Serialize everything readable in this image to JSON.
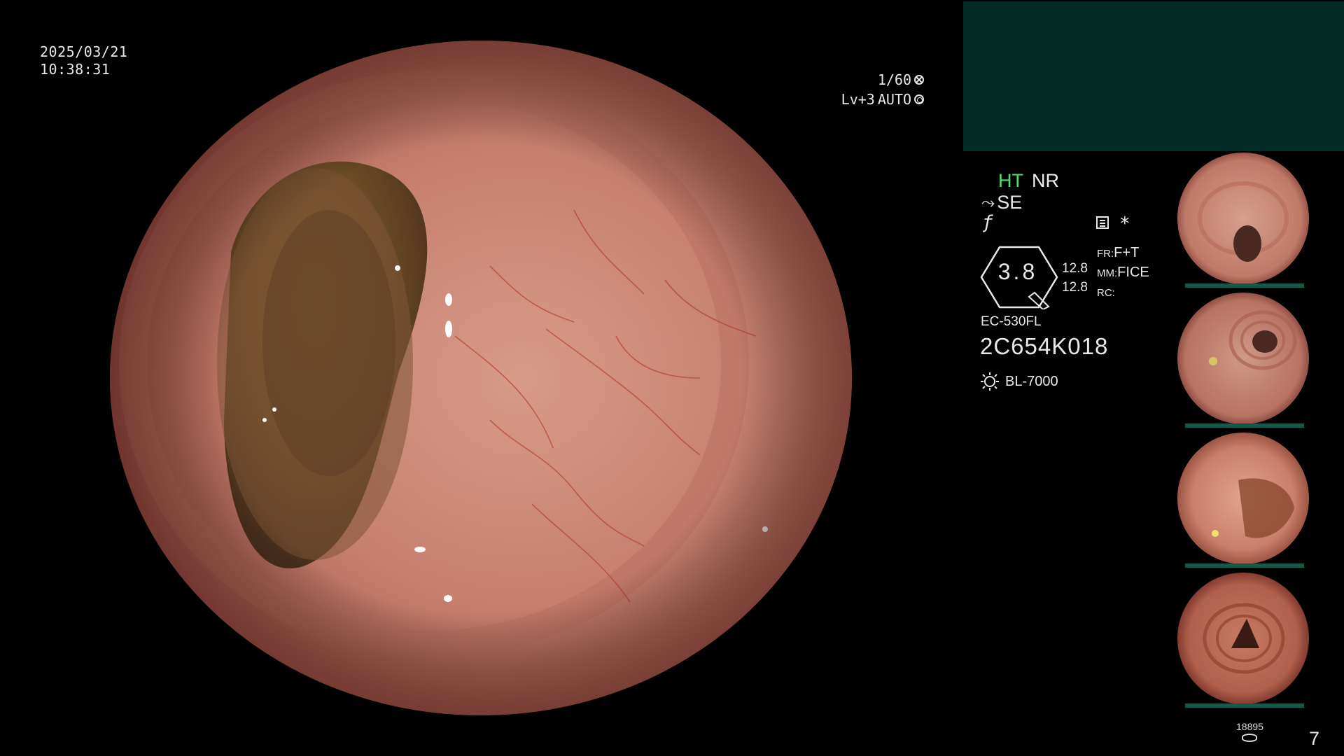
{
  "overlay": {
    "date": "2025/03/21",
    "time": "10:38:31",
    "shutter": "1/60",
    "level": "Lv+3",
    "exposure_mode": "AUTO"
  },
  "status": {
    "enhancement": "HT",
    "noise_reduction": "NR",
    "structure": "SE",
    "zoom_value": "3.8",
    "gauge_top": "12.8",
    "gauge_bottom": "12.8",
    "settings": [
      {
        "key": "FR:",
        "value": "F+T"
      },
      {
        "key": "MM:",
        "value": "FICE"
      },
      {
        "key": "RC:",
        "value": ""
      }
    ],
    "scope_model": "EC-530FL",
    "scope_serial": "2C654K018",
    "light_source": "BL-7000"
  },
  "thumbnails": [
    {
      "label": "thumbnail-1"
    },
    {
      "label": "thumbnail-2"
    },
    {
      "label": "thumbnail-3"
    },
    {
      "label": "thumbnail-4"
    }
  ],
  "footer": {
    "image_count": "18895",
    "page": "7"
  },
  "icons": [
    "shutter-icon",
    "iris-icon",
    "se-icon",
    "f-icon",
    "menu-icon",
    "light-bulb-icon",
    "database-icon"
  ],
  "colors": {
    "ht_green": "#4fe26b",
    "patient_panel": "#012b24",
    "thumb_bar": "#0f5c4b"
  }
}
